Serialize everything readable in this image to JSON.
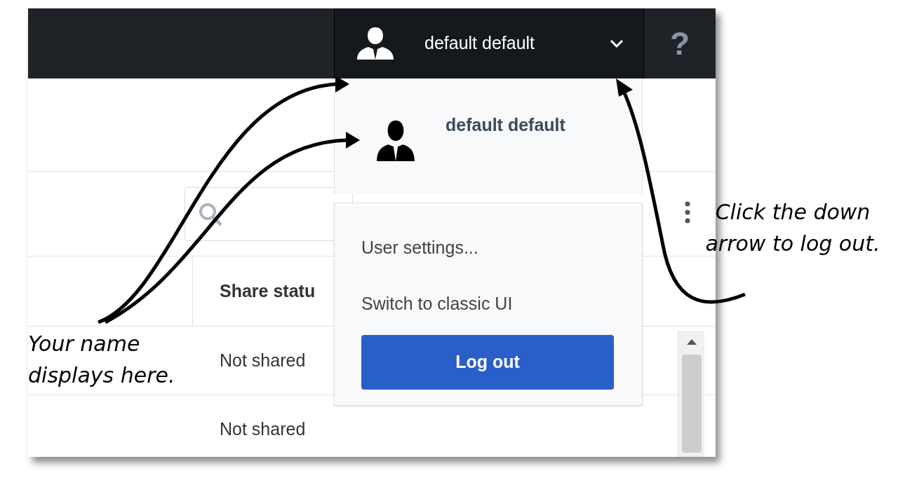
{
  "top_bar": {
    "user_name": "default default",
    "help": "?"
  },
  "user_menu": {
    "expanded": true,
    "profile_name": "default default",
    "items": [
      {
        "label": "User settings..."
      },
      {
        "label": "Switch to classic UI"
      }
    ],
    "logout_button": "Log out"
  },
  "table": {
    "columns": [
      "Share statu"
    ],
    "rows": [
      [
        "Not shared"
      ],
      [
        "Not shared"
      ]
    ]
  },
  "annotations": [
    {
      "text": "Your name displays here."
    },
    {
      "text": "Click the down arrow to log out."
    }
  ]
}
